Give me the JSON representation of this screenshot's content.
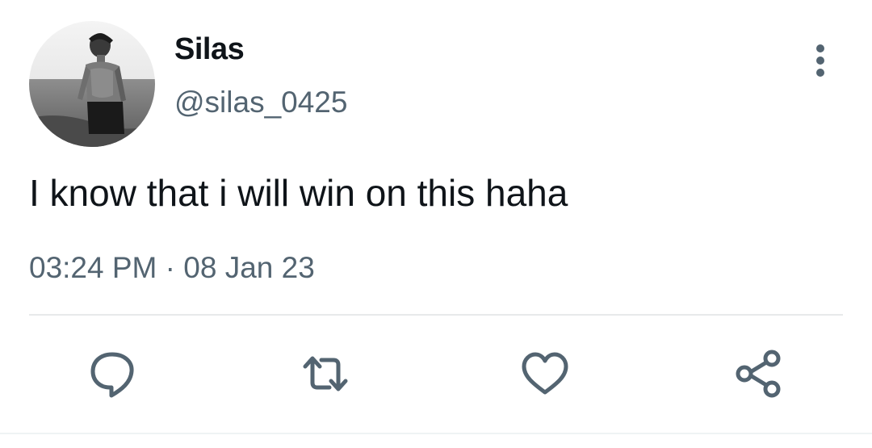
{
  "tweet": {
    "display_name": "Silas",
    "handle": "@silas_0425",
    "text": "I know that i will win on this haha",
    "time": "03:24 PM",
    "separator": "·",
    "date": "08 Jan 23"
  },
  "icons": {
    "avatar": "profile-photo",
    "more": "more-vertical-icon",
    "reply": "reply-icon",
    "retweet": "retweet-icon",
    "like": "heart-icon",
    "share": "share-icon"
  },
  "colors": {
    "text": "#0f1419",
    "secondary": "#536471",
    "icon": "#536471",
    "divider": "#e7e9ea"
  }
}
